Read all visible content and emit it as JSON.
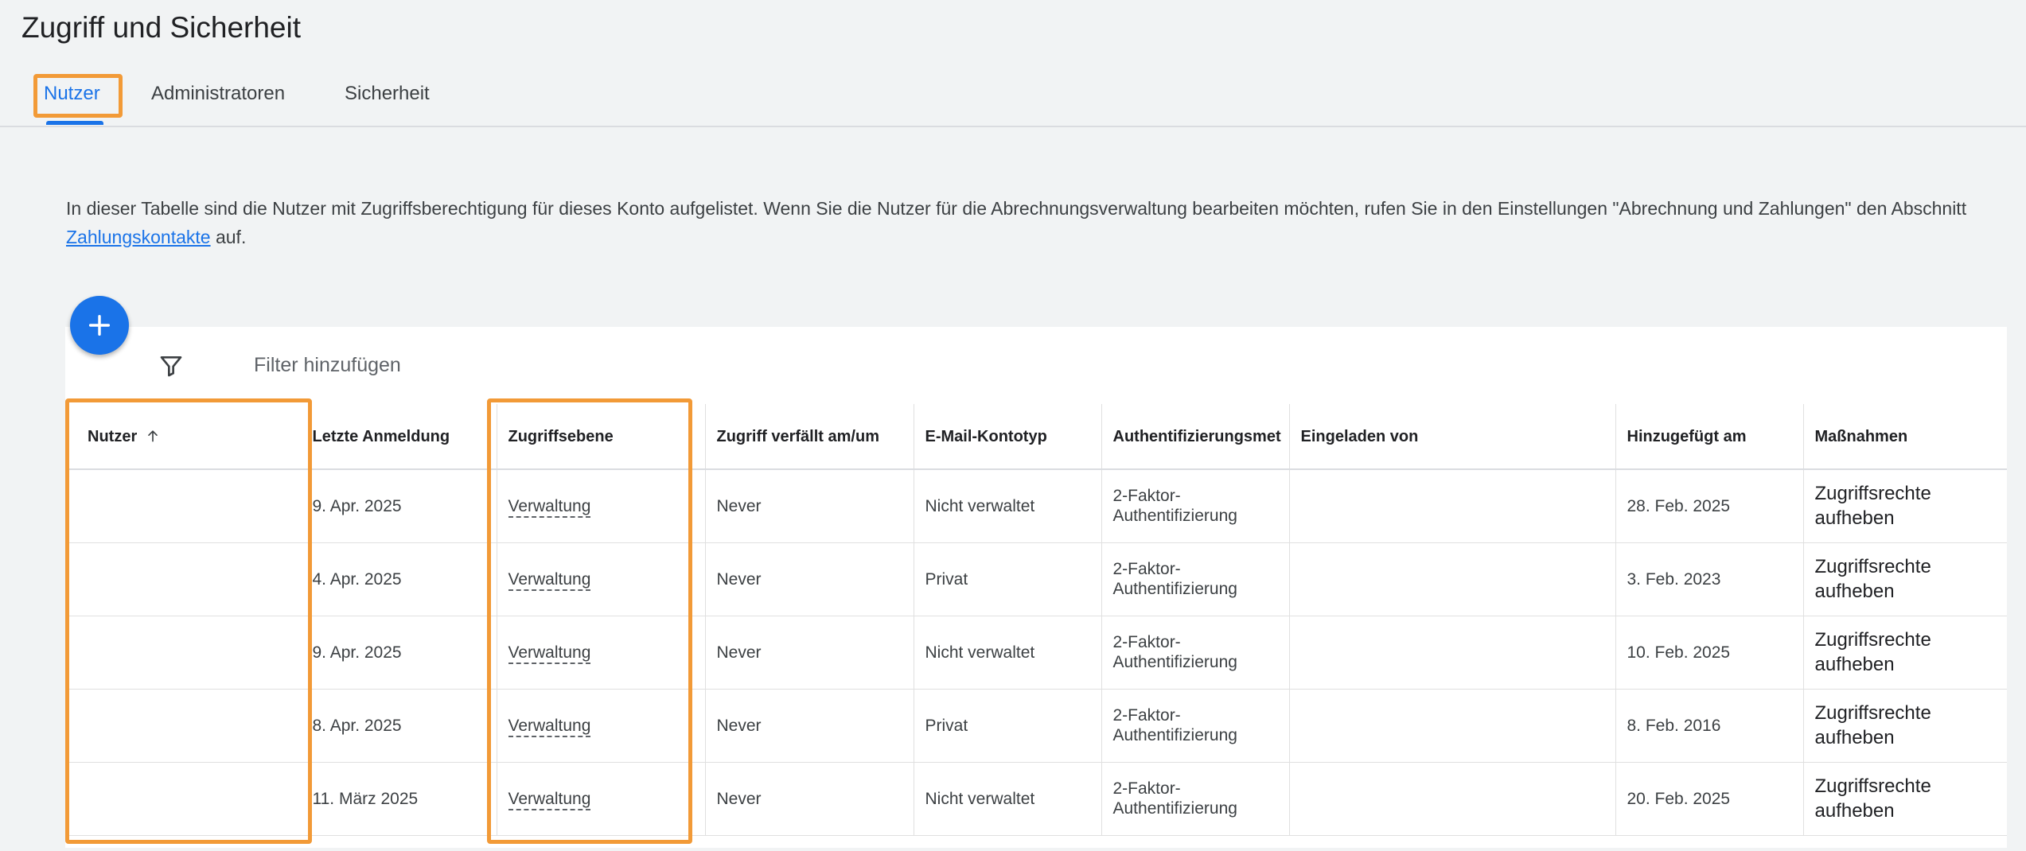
{
  "page": {
    "title": "Zugriff und Sicherheit"
  },
  "tabs": [
    {
      "label": "Nutzer",
      "active": true
    },
    {
      "label": "Administratoren",
      "active": false
    },
    {
      "label": "Sicherheit",
      "active": false
    }
  ],
  "description": {
    "text_before": "In dieser Tabelle sind die Nutzer mit Zugriffsberechtigung für dieses Konto aufgelistet. Wenn Sie die Nutzer für die Abrechnungsverwaltung bearbeiten möchten, rufen Sie in den Einstellungen \"Abrechnung und Zahlungen\" den Abschnitt ",
    "link": "Zahlungskontakte",
    "text_after": " auf."
  },
  "toolbar": {
    "add_icon": "plus-icon",
    "filter_icon": "filter-icon",
    "filter_label": "Filter hinzufügen"
  },
  "table": {
    "columns": {
      "user": "Nutzer",
      "last_login": "Letzte Anmeldung",
      "access_level": "Zugriffsebene",
      "expires": "Zugriff verfällt am/um",
      "email_type": "E-Mail-Kontotyp",
      "auth_method": "Authentifizierungsmet",
      "invited_by": "Eingeladen von",
      "added_on": "Hinzugefügt am",
      "actions": "Maßnahmen"
    },
    "sort": {
      "column": "user",
      "direction": "ascending",
      "icon": "arrow-up-icon"
    },
    "rows": [
      {
        "user": "",
        "last_login": "9. Apr. 2025",
        "access_level": "Verwaltung",
        "expires": "Never",
        "email_type": "Nicht verwaltet",
        "auth_method": "2-Faktor-Authentifizierung",
        "invited_by": "",
        "added_on": "28. Feb. 2025",
        "action": "Zugriffsrechte aufheben"
      },
      {
        "user": "",
        "last_login": "4. Apr. 2025",
        "access_level": "Verwaltung",
        "expires": "Never",
        "email_type": "Privat",
        "auth_method": "2-Faktor-Authentifizierung",
        "invited_by": "",
        "added_on": "3. Feb. 2023",
        "action": "Zugriffsrechte aufheben"
      },
      {
        "user": "",
        "last_login": "9. Apr. 2025",
        "access_level": "Verwaltung",
        "expires": "Never",
        "email_type": "Nicht verwaltet",
        "auth_method": "2-Faktor-Authentifizierung",
        "invited_by": "",
        "added_on": "10. Feb. 2025",
        "action": "Zugriffsrechte aufheben"
      },
      {
        "user": "",
        "last_login": "8. Apr. 2025",
        "access_level": "Verwaltung",
        "expires": "Never",
        "email_type": "Privat",
        "auth_method": "2-Faktor-Authentifizierung",
        "invited_by": "",
        "added_on": "8. Feb. 2016",
        "action": "Zugriffsrechte aufheben"
      },
      {
        "user": "",
        "last_login": "11. März 2025",
        "access_level": "Verwaltung",
        "expires": "Never",
        "email_type": "Nicht verwaltet",
        "auth_method": "2-Faktor-Authentifizierung",
        "invited_by": "",
        "added_on": "20. Feb. 2025",
        "action": "Zugriffsrechte aufheben"
      }
    ]
  },
  "colors": {
    "accent": "#1a73e8",
    "highlight": "#f29a37",
    "background": "#f1f3f4"
  }
}
